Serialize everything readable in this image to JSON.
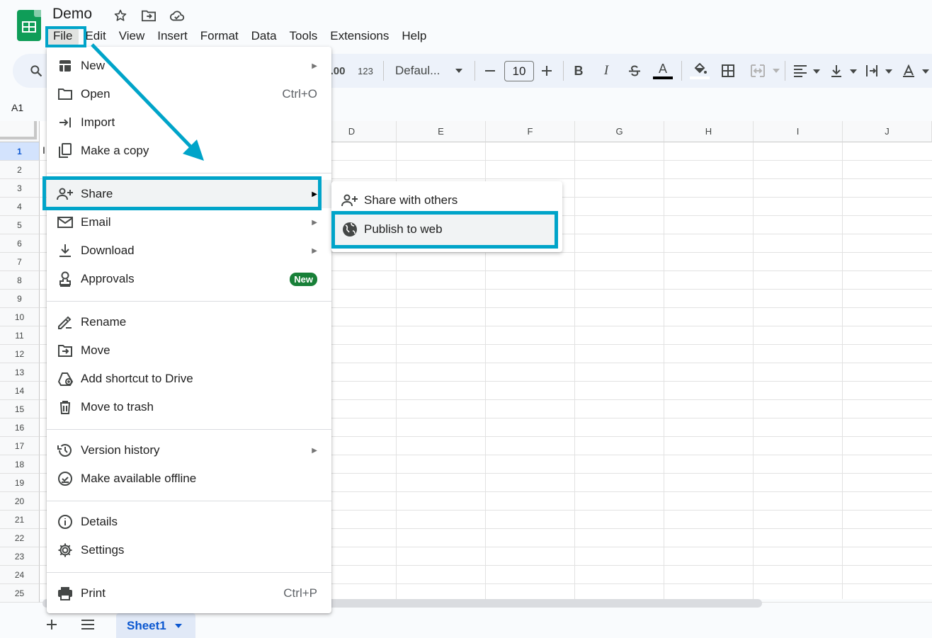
{
  "doc": {
    "title": "Demo"
  },
  "menubar": [
    "File",
    "Edit",
    "View",
    "Insert",
    "Format",
    "Data",
    "Tools",
    "Extensions",
    "Help"
  ],
  "toolbar": {
    "number_format_123": "123",
    "decimal_label": ".00",
    "font_family": "Defaul...",
    "font_size": "10",
    "bold": "B",
    "italic": "I",
    "text_color_letter": "A"
  },
  "namebox": "A1",
  "columns": [
    "D",
    "E",
    "F",
    "G",
    "H",
    "I",
    "J"
  ],
  "rows": [
    "1",
    "2",
    "3",
    "4",
    "5",
    "6",
    "7",
    "8",
    "9",
    "10",
    "11",
    "12",
    "13",
    "14",
    "15",
    "16",
    "17",
    "18",
    "19",
    "20",
    "21",
    "22",
    "23",
    "24",
    "25"
  ],
  "cell_a1_fragment": "I",
  "file_menu": {
    "items": [
      {
        "label": "New",
        "icon": "new-sheet-icon",
        "submenu": true
      },
      {
        "label": "Open",
        "icon": "folder-icon",
        "shortcut": "Ctrl+O"
      },
      {
        "label": "Import",
        "icon": "import-icon"
      },
      {
        "label": "Make a copy",
        "icon": "copy-icon"
      },
      {
        "label": "Share",
        "icon": "share-person-icon",
        "submenu": true
      },
      {
        "label": "Email",
        "icon": "mail-icon",
        "submenu": true
      },
      {
        "label": "Download",
        "icon": "download-icon",
        "submenu": true
      },
      {
        "label": "Approvals",
        "icon": "approvals-icon",
        "badge": "New"
      },
      {
        "label": "Rename",
        "icon": "rename-icon"
      },
      {
        "label": "Move",
        "icon": "move-folder-icon"
      },
      {
        "label": "Add shortcut to Drive",
        "icon": "drive-shortcut-icon"
      },
      {
        "label": "Move to trash",
        "icon": "trash-icon"
      },
      {
        "label": "Version history",
        "icon": "history-icon",
        "submenu": true
      },
      {
        "label": "Make available offline",
        "icon": "offline-icon"
      },
      {
        "label": "Details",
        "icon": "info-icon"
      },
      {
        "label": "Settings",
        "icon": "gear-icon"
      },
      {
        "label": "Print",
        "icon": "print-icon",
        "shortcut": "Ctrl+P"
      }
    ]
  },
  "share_submenu": {
    "items": [
      {
        "label": "Share with others",
        "icon": "share-person-icon"
      },
      {
        "label": "Publish to web",
        "icon": "globe-icon"
      }
    ]
  },
  "bottom": {
    "sheet_tab": "Sheet1"
  },
  "colors": {
    "highlight": "#00a4c9",
    "sheets_green": "#0f9d58",
    "badge_green": "#188038"
  }
}
